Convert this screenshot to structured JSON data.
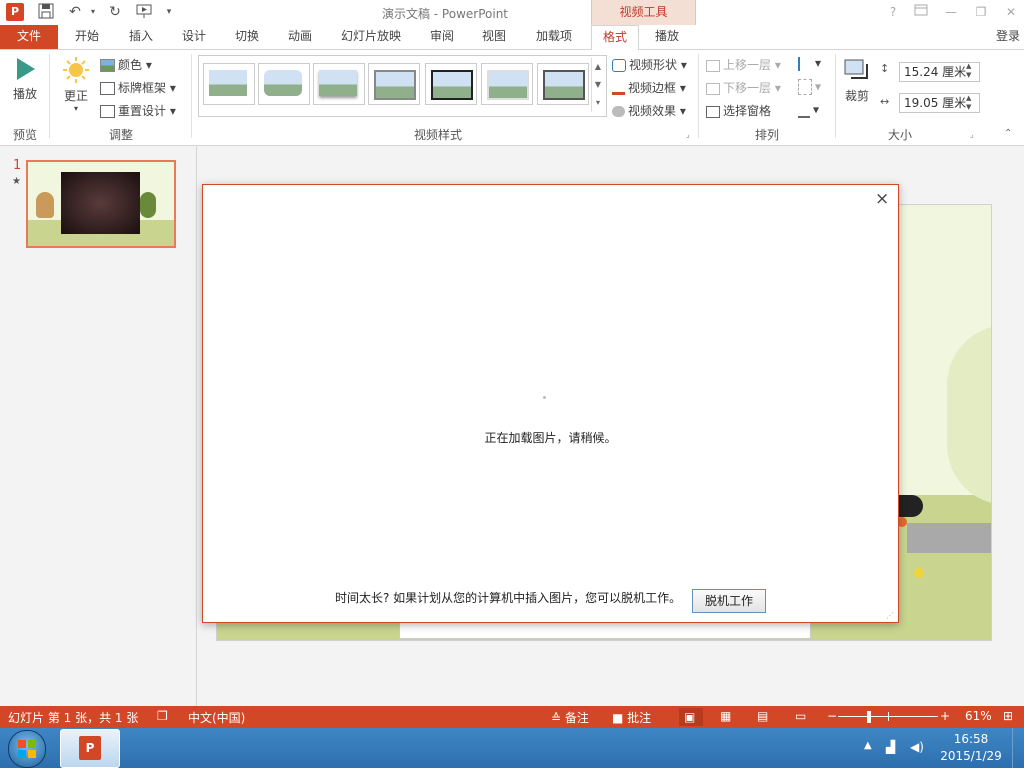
{
  "window": {
    "title": "演示文稿 - PowerPoint",
    "context_group": "视频工具",
    "help": "?",
    "login": "登录"
  },
  "tabs": {
    "file": "文件",
    "items": [
      "开始",
      "插入",
      "设计",
      "切换",
      "动画",
      "幻灯片放映",
      "审阅",
      "视图",
      "加载项",
      "格式",
      "播放"
    ],
    "active": "格式"
  },
  "ribbon": {
    "preview": {
      "button": "播放",
      "group": "预览"
    },
    "adjust": {
      "correct": "更正",
      "color": "颜色",
      "poster_frame": "标牌框架",
      "reset_design": "重置设计",
      "group": "调整"
    },
    "video_styles": {
      "group": "视频样式",
      "shape": "视频形状",
      "border": "视频边框",
      "effects": "视频效果"
    },
    "arrange": {
      "bring_forward": "上移一层",
      "send_backward": "下移一层",
      "selection_pane": "选择窗格",
      "group": "排列"
    },
    "size": {
      "crop": "裁剪",
      "height": "15.24 厘米",
      "width": "19.05 厘米",
      "group": "大小"
    }
  },
  "slides_pane": {
    "number": "1",
    "star": "★"
  },
  "dialog": {
    "loading_text": "正在加载图片，请稍候。",
    "hint": "时间太长? 如果计划从您的计算机中插入图片，您可以脱机工作。",
    "offline_button": "脱机工作",
    "close": "×"
  },
  "statusbar": {
    "slide_info": "幻灯片 第 1 张，共 1 张",
    "language": "中文(中国)",
    "notes": "备注",
    "comments": "批注",
    "zoom": "61%",
    "zoom_level": 0.61
  },
  "taskbar": {
    "time": "16:58",
    "date": "2015/1/29"
  },
  "colors": {
    "accent": "#d24726",
    "taskbar": "#2d6fae"
  }
}
